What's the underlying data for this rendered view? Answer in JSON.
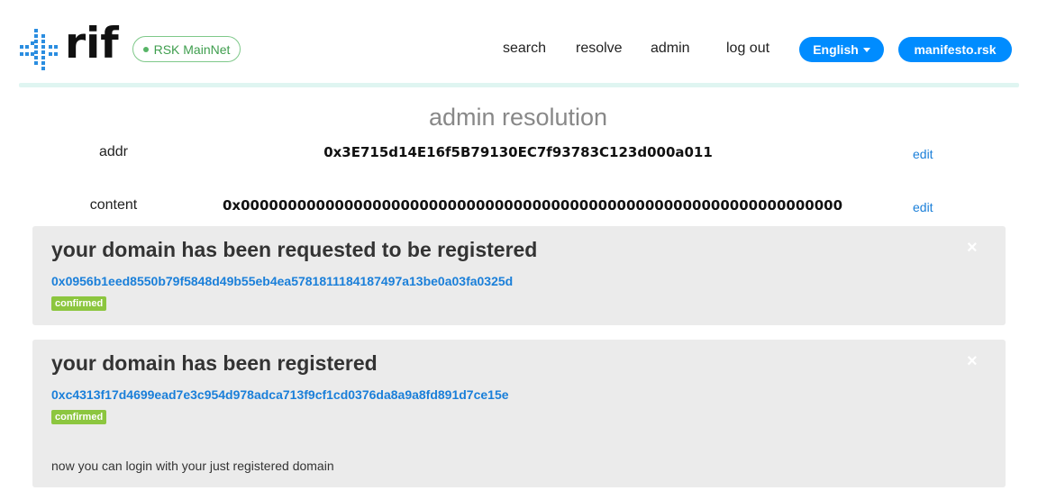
{
  "header": {
    "logo_text": "rif",
    "network": "RSK MainNet",
    "nav": {
      "search": "search",
      "resolve": "resolve",
      "admin": "admin",
      "logout": "log out"
    },
    "language": "English",
    "domain": "manifesto.rsk"
  },
  "main": {
    "title": "admin resolution",
    "resolutions": [
      {
        "label": "addr",
        "value": "0x3E715d14E16f5B79130EC7f93783C123d000a011",
        "edit": "edit"
      },
      {
        "label": "content",
        "value": "0x0000000000000000000000000000000000000000000000000000000000000000",
        "edit": "edit"
      }
    ]
  },
  "alerts": [
    {
      "title": "your domain has been requested to be registered",
      "tx": "0x0956b1eed8550b79f5848d49b55eb4ea5781811184187497a13be0a03fa0325d",
      "status": "confirmed",
      "close": "×"
    },
    {
      "title": "your domain has been registered",
      "tx": "0xc4313f17d4699ead7e3c954d978adca713f9cf1cd0376da8a9a8fd891d7ce15e",
      "status": "confirmed",
      "close": "×",
      "note": "now you can login with your just registered domain"
    }
  ],
  "colors": {
    "accent": "#008cff",
    "link": "#1a7fd9",
    "success": "#8cc63f",
    "network": "#3f9e4e",
    "alert_bg": "#ebebeb",
    "header_line": "#dff5f1"
  },
  "icons": {
    "logo": "rif-logo-icon",
    "network_status": "status-dot-icon",
    "dropdown": "caret-down-icon",
    "close": "close-icon"
  }
}
